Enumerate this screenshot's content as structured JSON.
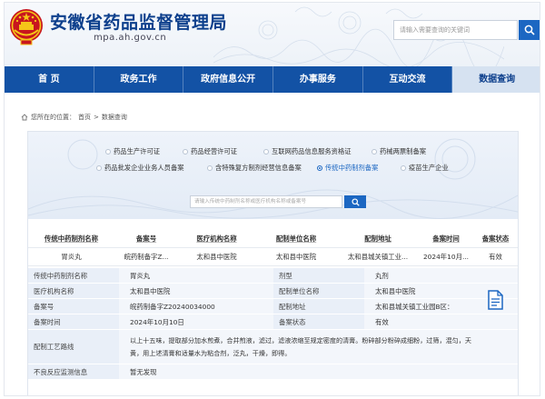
{
  "header": {
    "title": "安徽省药品监督管理局",
    "domain": "mpa.ah.gov.cn",
    "search_placeholder": "请输入需要查询的关键词"
  },
  "nav": [
    {
      "label": "首  页",
      "active": false
    },
    {
      "label": "政务工作",
      "active": false
    },
    {
      "label": "政府信息公开",
      "active": false
    },
    {
      "label": "办事服务",
      "active": false
    },
    {
      "label": "互动交流",
      "active": false
    },
    {
      "label": "数据查询",
      "active": true
    }
  ],
  "breadcrumb": {
    "prefix": "您所在的位置：",
    "home": "首页",
    "sep": ">",
    "current": "数据查询"
  },
  "categories": [
    {
      "label": "药品生产许可证",
      "active": false
    },
    {
      "label": "药品经营许可证",
      "active": false
    },
    {
      "label": "互联网药品信息服务资格证",
      "active": false
    },
    {
      "label": "药械两票制备案",
      "active": false
    },
    {
      "label": "药品批发企业业务人员备案",
      "active": false
    },
    {
      "label": "含特殊复方制剂经营信息备案",
      "active": false
    },
    {
      "label": "传统中药制剂备案",
      "active": true
    },
    {
      "label": "疫苗生产企业",
      "active": false
    }
  ],
  "query": {
    "placeholder": "请输入传统中药制剂名称或医疗机构名称或备案号"
  },
  "results": {
    "columns": [
      "传统中药制剂名称",
      "备案号",
      "医疗机构名称",
      "配制单位名称",
      "配制地址",
      "备案时间",
      "备案状态"
    ],
    "rows": [
      [
        "胃炎丸",
        "皖药制备字Z...",
        "太和县中医院",
        "太和县中医院",
        "太和县城关镇工业...",
        "2024年10月...",
        "有效"
      ]
    ]
  },
  "detail": {
    "labels": {
      "name": "传统中药制剂名称",
      "dosage_form": "剂型",
      "institution": "医疗机构名称",
      "prep_unit": "配制单位名称",
      "record_no": "备案号",
      "prep_address": "配制地址",
      "record_time": "备案时间",
      "record_status": "备案状态",
      "process": "配制工艺路线",
      "adverse": "不良反应监测信息"
    },
    "values": {
      "name": "胃炎丸",
      "dosage_form": "丸剂",
      "institution": "太和县中医院",
      "prep_unit": "太和县中医院",
      "record_no": "皖药制备字Z20240034000",
      "prep_address": "太和县城关镇工业园B区：",
      "record_time": "2024年10月10日",
      "record_status": "有效",
      "process_line1": "以上十五味，提取部分加水煎煮，合并煎液，滤过，滤液浓缩至规定密度的清膏。粉碎部分粉碎成细粉，过筛，混匀，天",
      "process_line2": "黄，用上述清膏和适量水为粘合剂，泛丸，干燥，即得。",
      "adverse": "暂无发现"
    }
  },
  "colors": {
    "nav_bg": "#1352a5",
    "title": "#0d3f8c",
    "accent": "#1c67c2"
  }
}
